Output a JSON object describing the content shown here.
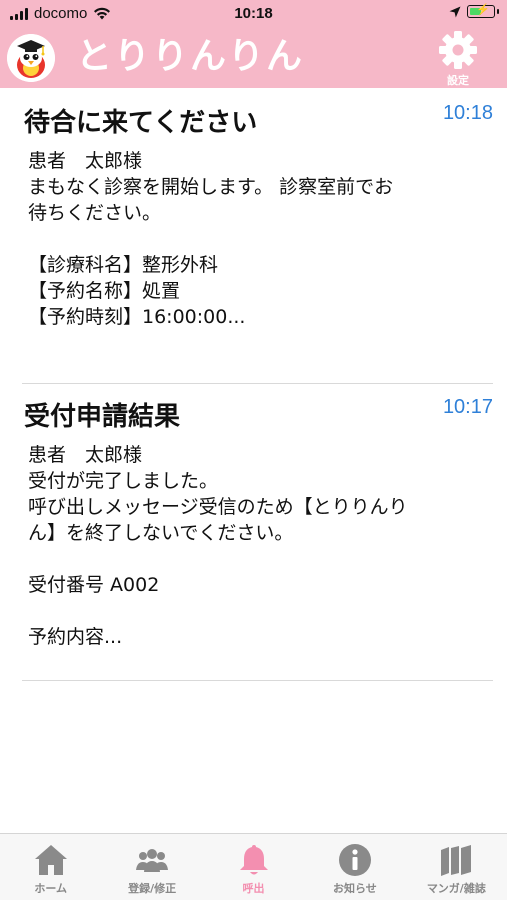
{
  "status_bar": {
    "carrier": "docomo",
    "time": "10:18"
  },
  "header": {
    "title": "とりりんりん",
    "settings_label": "設定"
  },
  "messages": [
    {
      "title": "待合に来てください",
      "time": "10:18",
      "body": "患者　太郎様\nまもなく診察を開始します。 診察室前でお\n待ちください。\n\n【診療科名】整形外科\n【予約名称】処置\n【予約時刻】16:00:00..."
    },
    {
      "title": "受付申請結果",
      "time": "10:17",
      "body": "患者　太郎様\n受付が完了しました。\n呼び出しメッセージ受信のため【とりりんり\nん】を終了しないでください。\n\n受付番号 A002\n\n予約内容..."
    }
  ],
  "tab_bar": {
    "tabs": [
      {
        "label": "ホーム",
        "icon": "home-icon"
      },
      {
        "label": "登録/修正",
        "icon": "users-icon"
      },
      {
        "label": "呼出",
        "icon": "bell-icon",
        "active": true
      },
      {
        "label": "お知らせ",
        "icon": "info-icon"
      },
      {
        "label": "マンガ/雑誌",
        "icon": "books-icon"
      }
    ]
  },
  "colors": {
    "header_background": "#f6b8c8",
    "time_text": "#2f80d8",
    "active_tab": "#f38fb0",
    "inactive_tab": "#888888"
  }
}
